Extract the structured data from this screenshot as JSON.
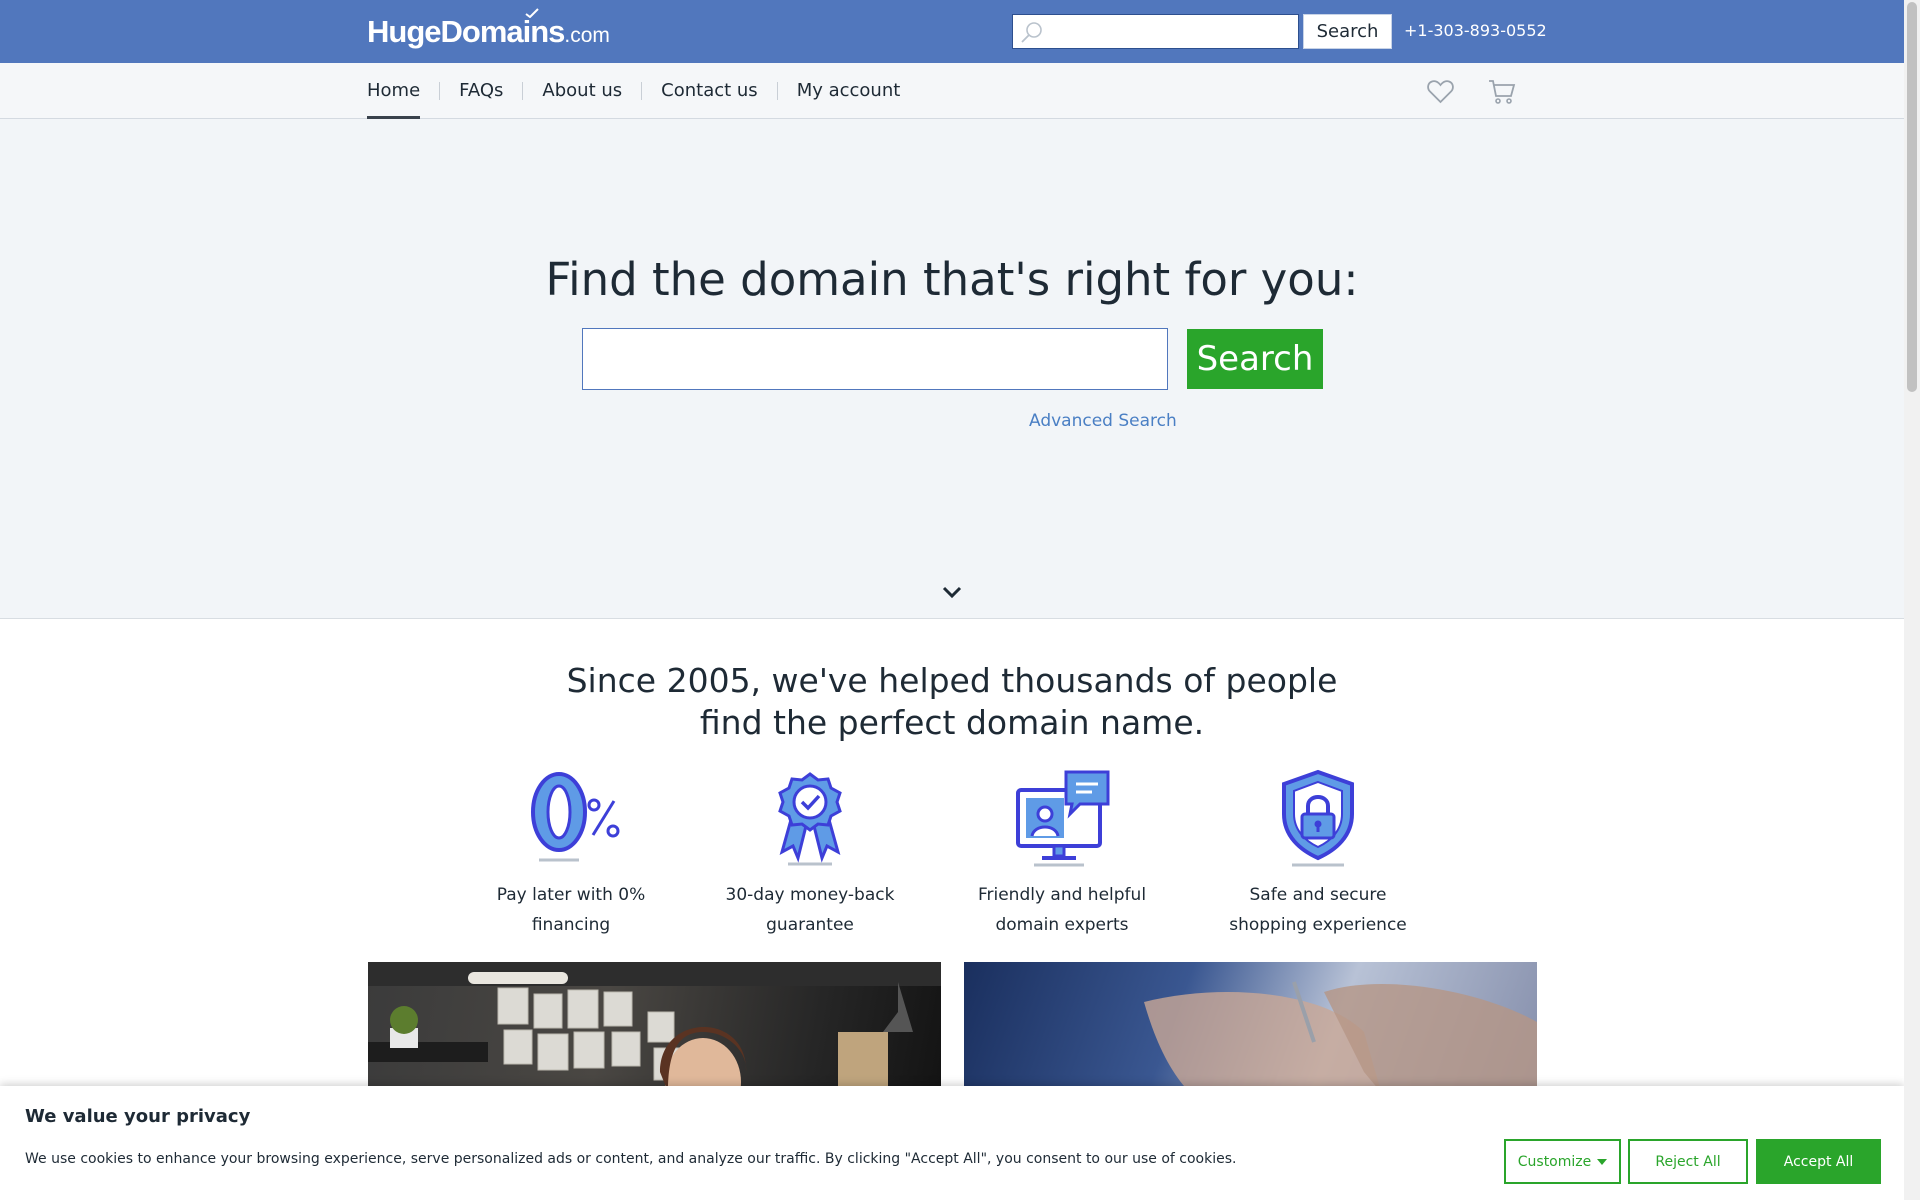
{
  "header": {
    "logo_main": "HugeDomains",
    "logo_tld": ".com",
    "search_placeholder": "",
    "search_button": "Search",
    "phone": "+1-303-893-0552"
  },
  "nav": {
    "items": [
      {
        "label": "Home",
        "active": true
      },
      {
        "label": "FAQs"
      },
      {
        "label": "About us"
      },
      {
        "label": "Contact us"
      },
      {
        "label": "My account"
      }
    ],
    "favorites_icon": "heart-icon",
    "cart_icon": "cart-icon"
  },
  "hero": {
    "title": "Find the domain that's right for you:",
    "search_value": "",
    "search_button": "Search",
    "advanced_link": "Advanced Search",
    "scroll_icon": "chevron-down-icon"
  },
  "intro": {
    "line1": "Since 2005, we've helped thousands of people",
    "line2": "find the perfect domain name."
  },
  "features": [
    {
      "icon": "zero-percent-icon",
      "line1": "Pay later with 0%",
      "line2": "financing"
    },
    {
      "icon": "award-ribbon-icon",
      "line1": "30-day money-back",
      "line2": "guarantee"
    },
    {
      "icon": "support-chat-icon",
      "line1": "Friendly and helpful",
      "line2": "domain experts"
    },
    {
      "icon": "shield-lock-icon",
      "line1": "Safe and secure",
      "line2": "shopping experience"
    }
  ],
  "cookie": {
    "title": "We value your privacy",
    "text": "We use cookies to enhance your browsing experience, serve personalized ads or content, and analyze our traffic. By clicking \"Accept All\", you consent to our use of cookies.",
    "customize": "Customize",
    "reject": "Reject All",
    "accept": "Accept All"
  },
  "colors": {
    "header_blue": "#5177bd",
    "accent_green": "#2aa52b",
    "link_blue": "#4a7fc4",
    "icon_blue": "#3d3fd8",
    "icon_light": "#5f9be6"
  }
}
